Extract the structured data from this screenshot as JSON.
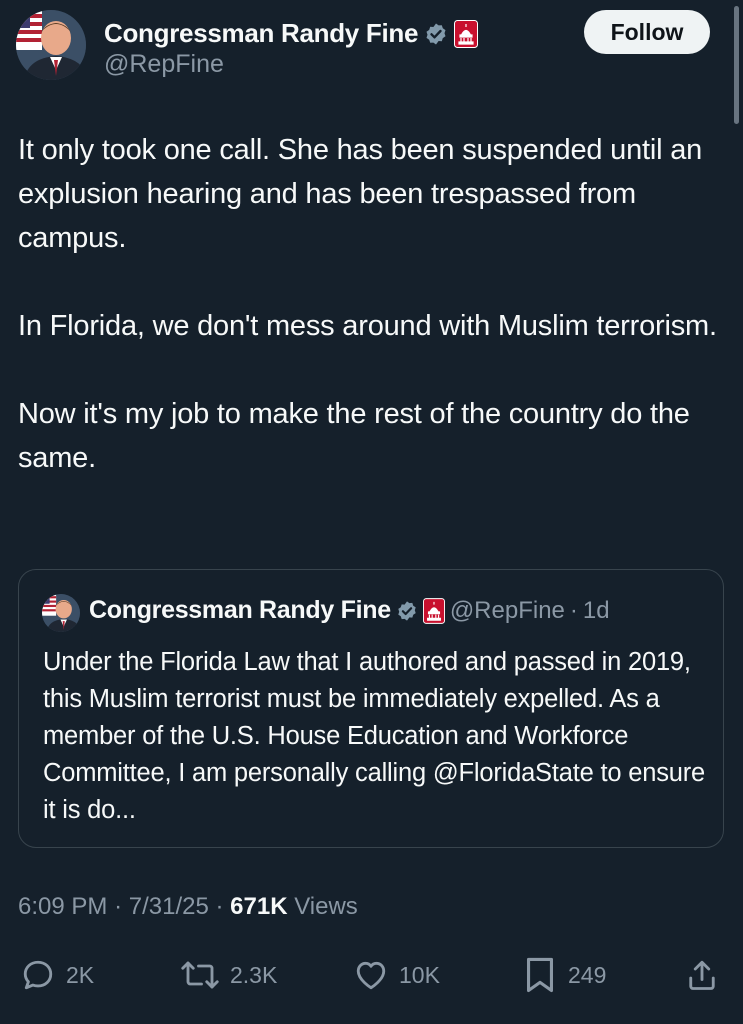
{
  "author": {
    "display_name": "Congressman Randy Fine",
    "handle": "@RepFine",
    "verified_icon": "verified-badge-icon",
    "affiliation_icon": "us-capitol-badge-icon"
  },
  "follow_button": {
    "label": "Follow"
  },
  "tweet": {
    "paragraphs": [
      "It only took one call.  She has been suspended until an explusion hearing and has been trespassed from campus.",
      "In Florida, we don't mess around with Muslim terrorism.",
      "Now it's my job to make the rest of the country do the same."
    ]
  },
  "quote": {
    "display_name": "Congressman Randy Fine",
    "handle": "@RepFine",
    "separator": "·",
    "time": "1d",
    "text": "Under the Florida Law that I authored and passed in 2019, this Muslim terrorist must be immediately expelled.   As a member of the U.S. House Education and Workforce Committee, I am personally calling @FloridaState to ensure it is do..."
  },
  "meta": {
    "time": "6:09 PM",
    "separator": "·",
    "date": "7/31/25",
    "views_count": "671K",
    "views_label": "Views"
  },
  "actions": {
    "replies": "2K",
    "reposts": "2.3K",
    "likes": "10K",
    "bookmarks": "249"
  },
  "colors": {
    "background": "#15202b",
    "text": "#f7f9f9",
    "secondary": "#8b98a5",
    "border": "#38444d",
    "verified": "#829aab",
    "affiliation": "#c8102e"
  }
}
